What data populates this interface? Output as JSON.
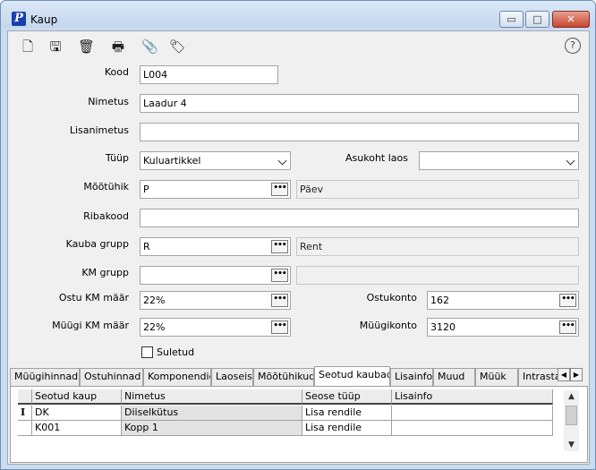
{
  "window": {
    "title": "Kaup",
    "app_glyph": "P",
    "minimize_glyph": "▭",
    "maximize_glyph": "□",
    "close_glyph": "✕"
  },
  "toolbar": {
    "new_glyph": "🗋",
    "save_glyph": "🖫",
    "delete_glyph": "🗑",
    "print_glyph": "🖶",
    "attach_glyph": "📎",
    "tag_glyph": "🏷",
    "help_glyph": "?"
  },
  "form": {
    "kood_label": "Kood",
    "kood_value": "L004",
    "nimetus_label": "Nimetus",
    "nimetus_value": "Laadur 4",
    "lisanimetus_label": "Lisanimetus",
    "lisanimetus_value": "",
    "tyyp_label": "Tüüp",
    "tyyp_value": "Kuluartikkel",
    "asukoht_label": "Asukoht laos",
    "asukoht_value": "",
    "mootyhik_label": "Mõõtühik",
    "mootyhik_value": "P",
    "mootyhik_name": "Päev",
    "ribakood_label": "Ribakood",
    "ribakood_value": "",
    "kaubagrupp_label": "Kauba grupp",
    "kaubagrupp_value": "R",
    "kaubagrupp_name": "Rent",
    "kmgrupp_label": "KM grupp",
    "kmgrupp_value": "",
    "kmgrupp_name": "",
    "ostukm_label": "Ostu KM määr",
    "ostukm_value": "22%",
    "ostukonto_label": "Ostukonto",
    "ostukonto_value": "162",
    "myygikm_label": "Müügi KM määr",
    "myygikm_value": "22%",
    "myygikonto_label": "Müügikonto",
    "myygikonto_value": "3120",
    "suletud_label": "Suletud",
    "ellipsis": "•••"
  },
  "tabs": [
    {
      "label": "Müügihinnad"
    },
    {
      "label": "Ostuhinnad"
    },
    {
      "label": "Komponendid"
    },
    {
      "label": "Laoseis"
    },
    {
      "label": "Mõõtühikud"
    },
    {
      "label": "Seotud kaubad"
    },
    {
      "label": "Lisainfo"
    },
    {
      "label": "Muud"
    },
    {
      "label": "Müük"
    },
    {
      "label": "Intrastat"
    }
  ],
  "tab_scroll": {
    "left": "◀",
    "right": "▶"
  },
  "grid": {
    "columns": [
      "Seotud kaup",
      "Nimetus",
      "Seose tüüp",
      "Lisainfo"
    ],
    "row_marker": "I",
    "rows": [
      [
        "DK",
        "Diiselkütus",
        "Lisa rendile",
        ""
      ],
      [
        "K001",
        "Kopp 1",
        "Lisa rendile",
        ""
      ]
    ],
    "scroll_up": "▲",
    "scroll_down": "▼"
  }
}
